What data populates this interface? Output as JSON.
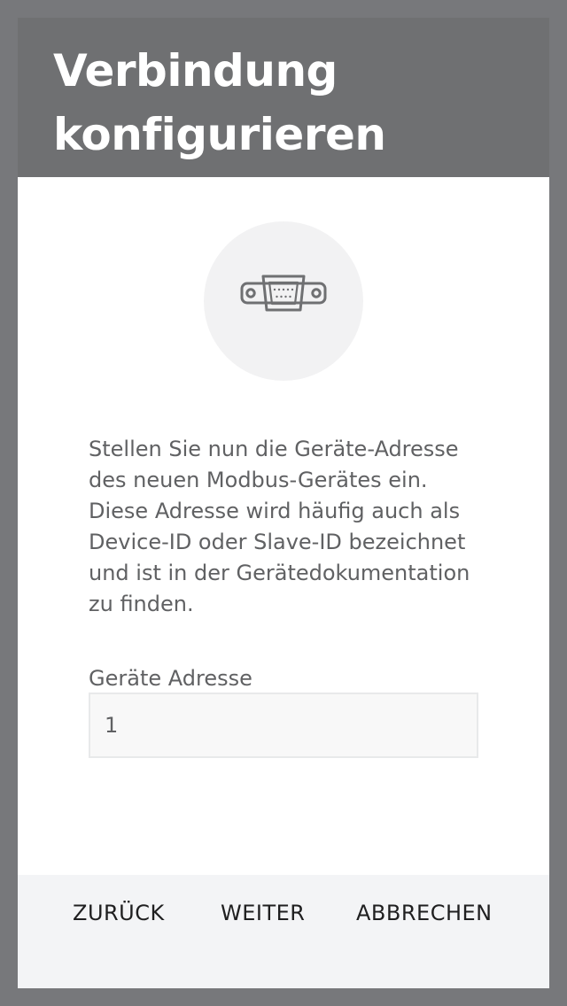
{
  "dialog": {
    "title": "Verbindung konfigurieren",
    "icon": "serial-port-icon",
    "description": "Stellen Sie nun die Geräte-Adresse des neuen Modbus-Gerätes ein. Diese Adresse wird häufig auch als Device-ID oder Slave-ID bezeichnet und ist in der Gerätedokumentation zu finden.",
    "field": {
      "label": "Geräte Adresse",
      "value": "1"
    },
    "footer": {
      "back_label": "ZURÜCK",
      "next_label": "WEITER",
      "cancel_label": "ABBRECHEN"
    }
  },
  "colors": {
    "backdrop": "#77787b",
    "header_background": "#6f7072",
    "footer_background": "#f3f4f6",
    "icon_circle": "#f2f2f3",
    "body_text": "#606163"
  }
}
